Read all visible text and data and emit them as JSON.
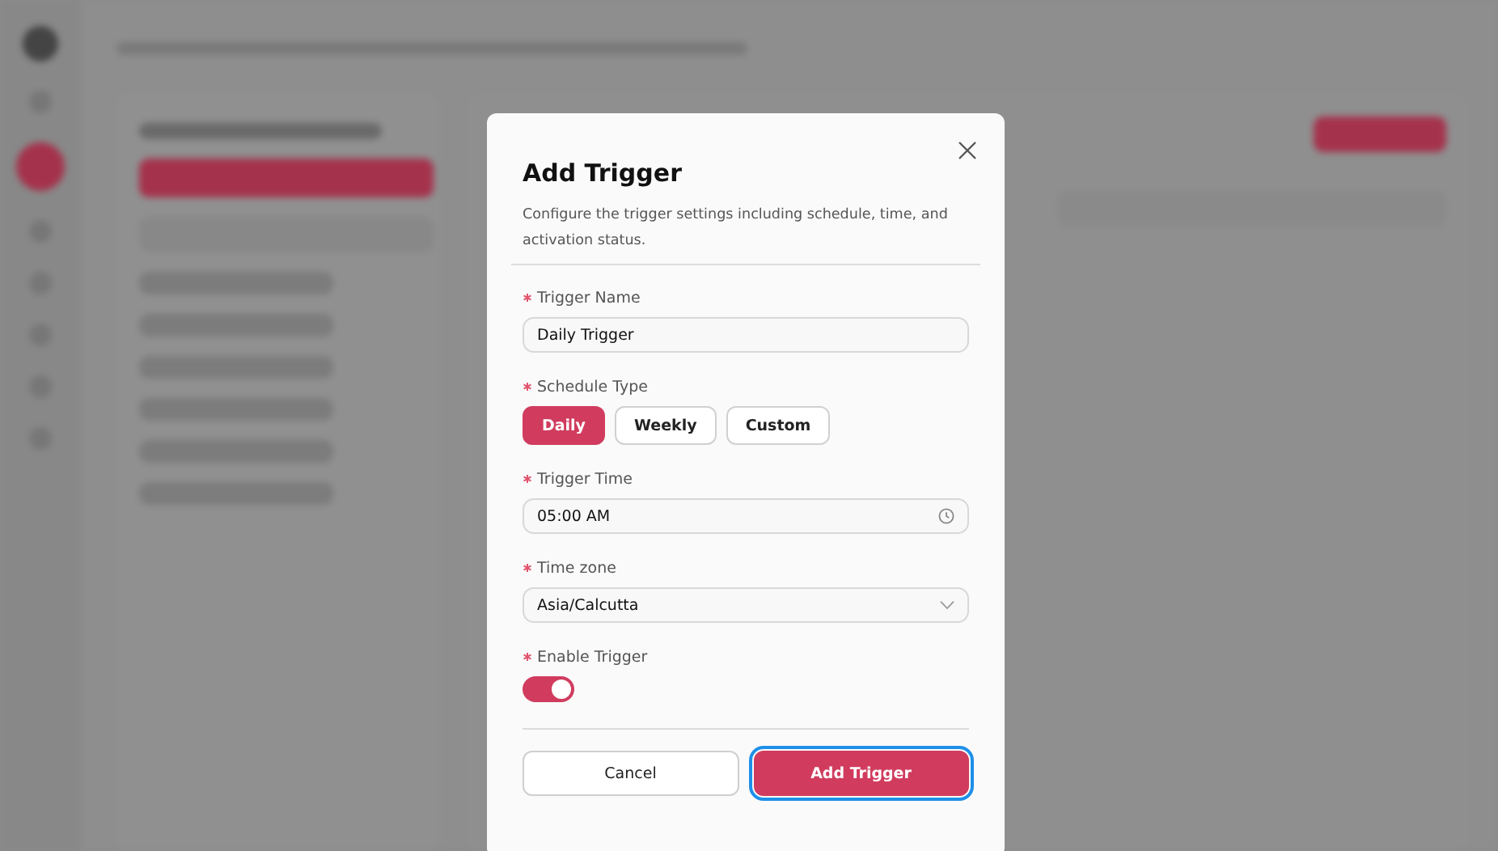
{
  "dialog": {
    "title": "Add Trigger",
    "description": "Configure the trigger settings including schedule, time, and activation status.",
    "fields": [
      {
        "kind": "text",
        "label": "Trigger Name",
        "required": true,
        "value": "Daily Trigger"
      },
      {
        "kind": "segmented",
        "label": "Schedule Type",
        "required": true,
        "options": [
          {
            "label": "Daily",
            "selected": true
          },
          {
            "label": "Weekly",
            "selected": false
          },
          {
            "label": "Custom",
            "selected": false
          }
        ]
      },
      {
        "kind": "time",
        "label": "Trigger Time",
        "required": true,
        "value": "05:00 AM"
      },
      {
        "kind": "select",
        "label": "Time zone",
        "required": true,
        "value": "Asia/Calcutta"
      },
      {
        "kind": "switch",
        "label": "Enable Trigger",
        "required": true,
        "on": true
      }
    ],
    "buttons": [
      {
        "label": "Cancel",
        "kind": "secondary",
        "focused": false
      },
      {
        "label": "Add Trigger",
        "kind": "primary",
        "focused": true
      }
    ]
  }
}
